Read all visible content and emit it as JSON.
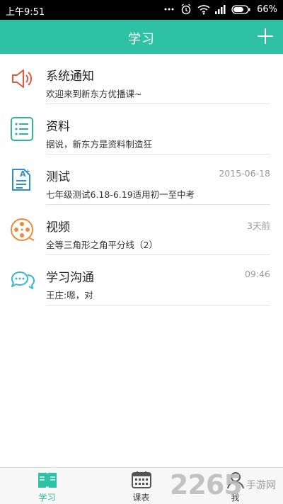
{
  "status_bar": {
    "time": "上午9:51",
    "battery": "66%",
    "icons": [
      "dots-icon",
      "alarm-icon",
      "wifi-icon",
      "signal-icon",
      "battery-icon"
    ]
  },
  "header": {
    "title": "学习",
    "add_icon": "plus-icon"
  },
  "colors": {
    "accent": "#2ec1a4",
    "speaker": "#e2573e",
    "doc": "#2fb59a",
    "test": "#2f8fd6",
    "video": "#f08a3a",
    "chat": "#35b8d6"
  },
  "list": [
    {
      "icon": "speaker-icon",
      "title": "系统通知",
      "sub": "欢迎来到新东方优播课~",
      "time": ""
    },
    {
      "icon": "document-list-icon",
      "title": "资料",
      "sub": "据说，新东方是资料制造狂",
      "time": ""
    },
    {
      "icon": "test-paper-icon",
      "title": "测试",
      "sub": "七年级测试6.18-6.19适用初一至中考",
      "time": "2015-06-18"
    },
    {
      "icon": "film-reel-icon",
      "title": "视频",
      "sub": "全等三角形之角平分线（2）",
      "time": "3天前"
    },
    {
      "icon": "chat-bubbles-icon",
      "title": "学习沟通",
      "sub": "王庄:嗯，对",
      "time": "09:46"
    }
  ],
  "bottom_nav": {
    "tabs": [
      {
        "label": "学习",
        "icon": "book-icon",
        "active": true
      },
      {
        "label": "课表",
        "icon": "calendar-icon",
        "active": false
      },
      {
        "label": "我",
        "icon": "person-icon",
        "active": false
      }
    ]
  },
  "watermark": {
    "number": "2265",
    "text": "手游网"
  }
}
